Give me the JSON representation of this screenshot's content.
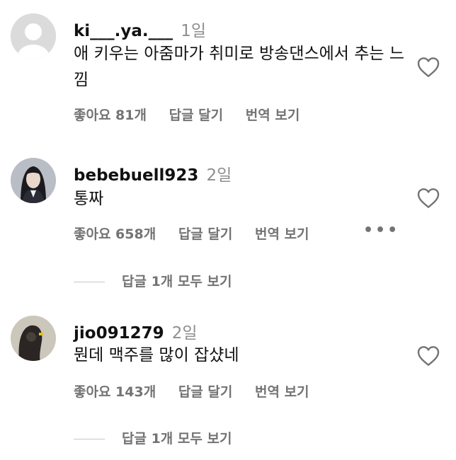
{
  "comments": [
    {
      "username": "ki___.ya.___",
      "time": "1일",
      "text": "애 키우는 아줌마가 취미로 방송댄스에서 추는 느낌",
      "likes": "좋아요 81개",
      "reply": "답글 달기",
      "translate": "번역 보기",
      "avatar_icon": "default-avatar-icon"
    },
    {
      "username": "bebebuell923",
      "time": "2일",
      "text": "통짜",
      "likes": "좋아요 658개",
      "reply": "답글 달기",
      "translate": "번역 보기",
      "more": "•••",
      "view_replies": "답글 1개 모두 보기"
    },
    {
      "username": "jio091279",
      "time": "2일",
      "text": "뭔데 맥주를 많이 잡샸네",
      "likes": "좋아요 143개",
      "reply": "답글 달기",
      "translate": "번역 보기",
      "view_replies": "답글 1개 모두 보기"
    }
  ],
  "colors": {
    "muted": "#737373",
    "time": "#8e8e8e",
    "text": "#111111"
  }
}
